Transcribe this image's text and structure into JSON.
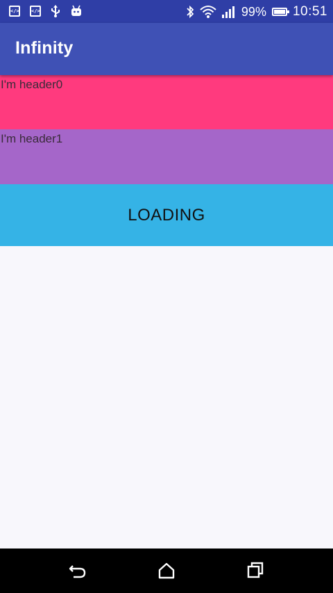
{
  "status_bar": {
    "left_icons": [
      "code-icon",
      "code-icon",
      "usb-icon",
      "android-icon"
    ],
    "right_icons": [
      "bluetooth-icon",
      "wifi-icon",
      "signal-icon"
    ],
    "battery_percent": "99%",
    "battery_level": 0.99,
    "time": "10:51"
  },
  "app_bar": {
    "title": "Infinity",
    "color": "#3f51b5"
  },
  "list": {
    "headers": [
      {
        "label": "I'm header0",
        "color": "#ff3a7e"
      },
      {
        "label": "I'm header1",
        "color": "#a566c9"
      }
    ],
    "loading": {
      "label": "LOADING",
      "color": "#35b3e6"
    }
  },
  "nav_bar": {
    "buttons": [
      "back-icon",
      "home-icon",
      "recent-apps-icon"
    ]
  }
}
